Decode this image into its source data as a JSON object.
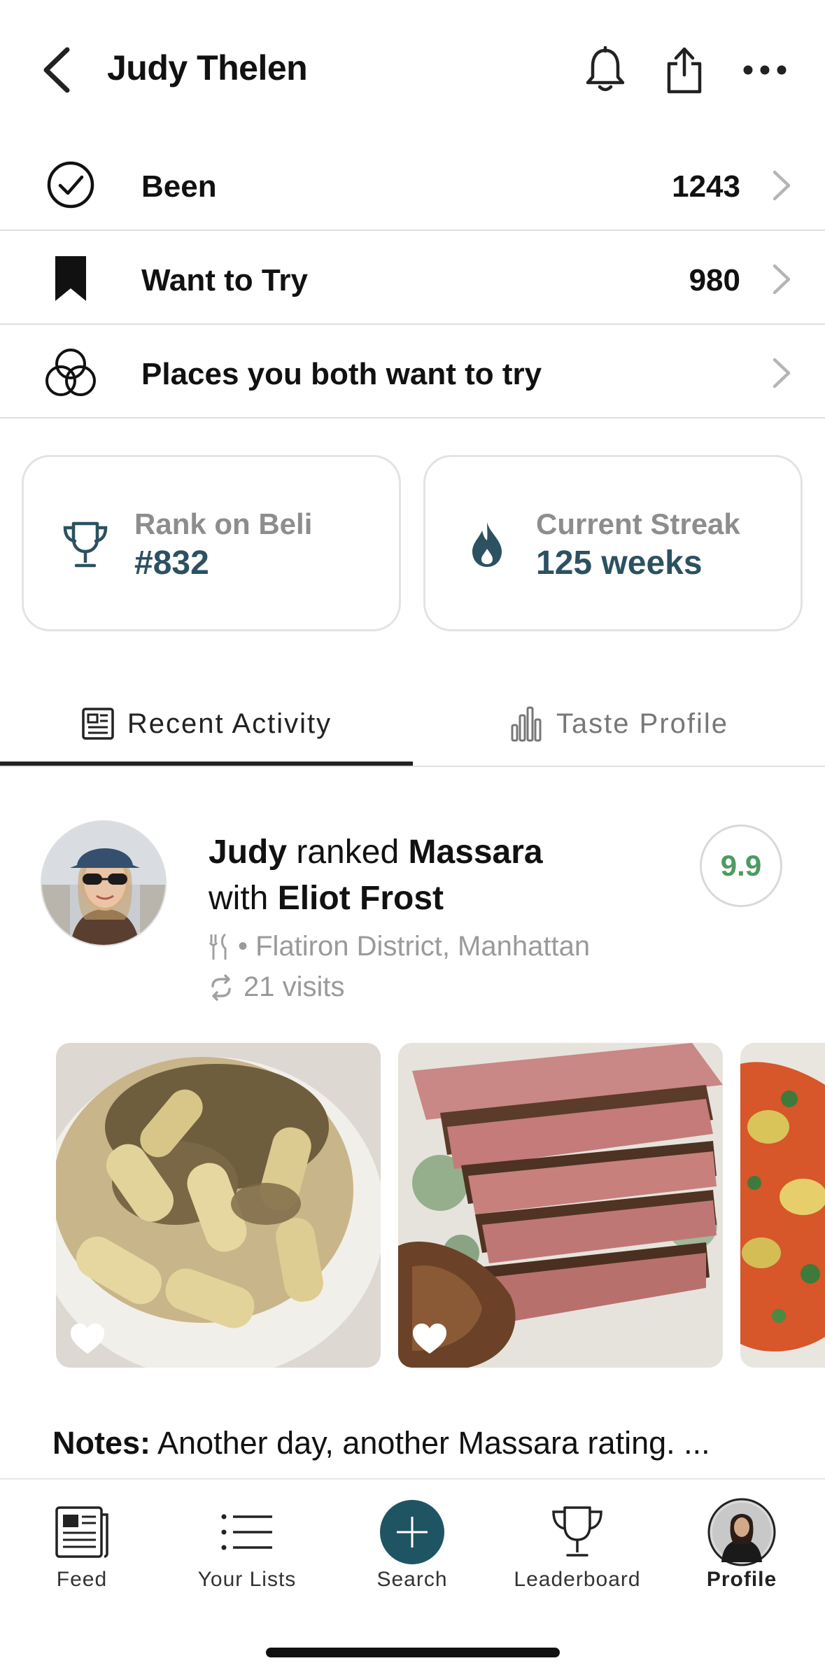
{
  "header": {
    "title": "Judy Thelen",
    "icons": [
      "chevron-left-icon",
      "bell-icon",
      "share-icon",
      "more-icon"
    ]
  },
  "rows": [
    {
      "label": "Been",
      "count": "1243",
      "icon": "check-circle-icon"
    },
    {
      "label": "Want to Try",
      "count": "980",
      "icon": "bookmark-icon"
    },
    {
      "label": "Places you both want to try",
      "count": "",
      "icon": "venn-icon"
    }
  ],
  "stats": {
    "rank": {
      "label": "Rank on Beli",
      "value": "#832",
      "icon": "trophy-icon"
    },
    "streak": {
      "label": "Current Streak",
      "value": "125 weeks",
      "icon": "flame-icon"
    }
  },
  "tabs": {
    "recent": "Recent Activity",
    "taste": "Taste Profile",
    "active": "recent"
  },
  "activity": {
    "user": "Judy",
    "verb": "ranked",
    "place": "Massara",
    "with_word": "with",
    "companion": "Eliot Frost",
    "location": "• Flatiron District, Manhattan",
    "visits": "21 visits",
    "score": "9.9",
    "score_color": "#4e9a63",
    "notes_label": "Notes:",
    "notes_text": "Another day, another Massara rating. ..."
  },
  "nav": {
    "feed": "Feed",
    "lists": "Your Lists",
    "search": "Search",
    "leaderboard": "Leaderboard",
    "profile": "Profile",
    "active": "profile"
  },
  "colors": {
    "accent": "#2c5161",
    "search_button": "#1f5563"
  }
}
